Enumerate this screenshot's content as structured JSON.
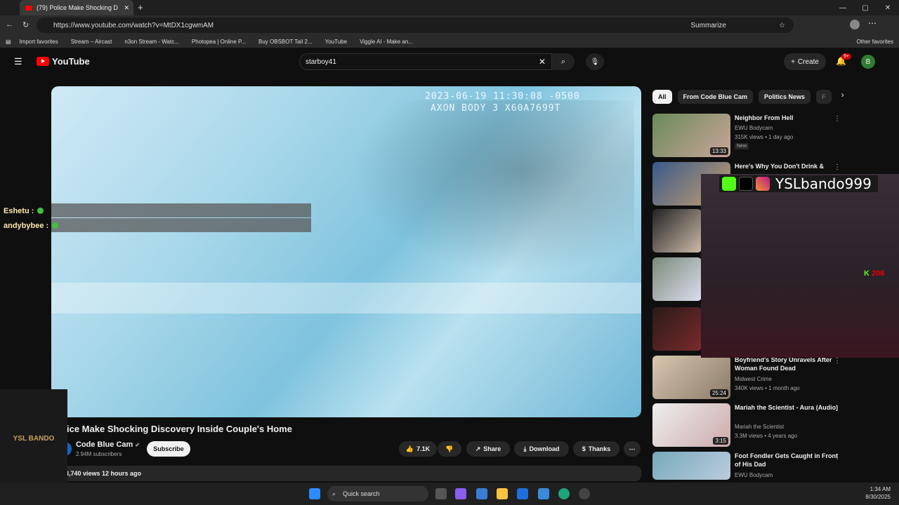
{
  "browser": {
    "tab_title": "(79) Police Make Shocking D",
    "url": "https://www.youtube.com/watch?v=MtDX1cgwmAM",
    "summarize_label": "Summarize",
    "bookmarks": [
      "Import favorites",
      "Stream – Aircast",
      "n3on Stream - Watc...",
      "Photopea | Online P...",
      "Buy OBSBOT Tail 2...",
      "YouTube",
      "Viggle AI - Make an..."
    ],
    "other_favorites": "Other favorites"
  },
  "youtube": {
    "logo": "YouTube",
    "search_value": "starboy41",
    "create_label": "Create",
    "notif_count": "9+",
    "avatar_letter": "B"
  },
  "video": {
    "timestamp_line1": "2023-06-19 11:30:08 -0500",
    "timestamp_line2": "AXON BODY 3 X60A7699T",
    "title": "ice Make Shocking Discovery Inside Couple's Home",
    "channel": "Code Blue Cam",
    "subscribers": "2.94M subscribers",
    "subscribe_label": "Subscribe",
    "likes": "7.1K",
    "share_label": "Share",
    "download_label": "Download",
    "thanks_label": "Thanks",
    "views_line": "3,740 views  12 hours ago"
  },
  "chat": [
    {
      "user": "Eshetu :"
    },
    {
      "user": "andybybee :"
    }
  ],
  "chips": [
    "All",
    "From Code Blue Cam",
    "Politics News",
    "F"
  ],
  "recommendations": [
    {
      "title": "Neighbor From Hell",
      "channel": "EWU Bodycam",
      "meta": "315K views • 1 day ago",
      "badge": "New",
      "duration": "13:33"
    },
    {
      "title": "Here's Why You Don't Drink &",
      "channel": "",
      "meta": "",
      "badge": "",
      "duration": ""
    },
    {
      "title": "Boyfriend's Story Unravels After Woman Found Dead",
      "channel": "Midwest Crime",
      "meta": "340K views • 1 month ago",
      "badge": "",
      "duration": "25:24"
    },
    {
      "title": "Mariah the Scientist - Aura (Audio)",
      "channel": "Mariah the Scientist",
      "meta": "3.3M views • 4 years ago",
      "badge": "",
      "duration": "3:15"
    },
    {
      "title": "Foot Fondler Gets Caught in Front of His Dad",
      "channel": "EWU Bodycam",
      "meta": "",
      "badge": "",
      "duration": ""
    }
  ],
  "stream_overlay": {
    "handle": "YSLbando999",
    "viewer_count": "206",
    "logo_text": "YSL BANDO"
  },
  "taskbar": {
    "search_placeholder": "Quick search",
    "time": "1:34 AM",
    "date": "8/30/2025"
  },
  "colors": {
    "accent": "#ff0000",
    "chat_dot": "#3ec13e"
  }
}
